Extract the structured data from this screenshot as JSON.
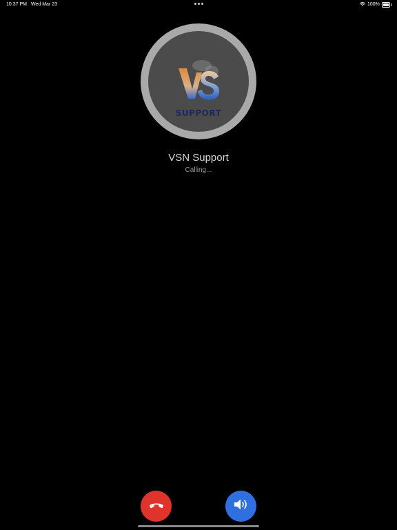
{
  "status_bar": {
    "time": "10:37 PM",
    "date": "Wed Mar 23",
    "battery": "100%"
  },
  "call": {
    "contact_name": "VSN Support",
    "status": "Calling...",
    "avatar_logo_text": "SUPPORT"
  },
  "icons": {
    "wifi": "wifi-icon",
    "battery": "battery-icon",
    "end_call": "phone-hangup-icon",
    "speaker": "speaker-icon",
    "more": "more-dots-icon"
  },
  "colors": {
    "end_call": "#e0332c",
    "speaker": "#2f6fe0",
    "avatar_ring": "#a9a9a9",
    "background": "#000000"
  }
}
